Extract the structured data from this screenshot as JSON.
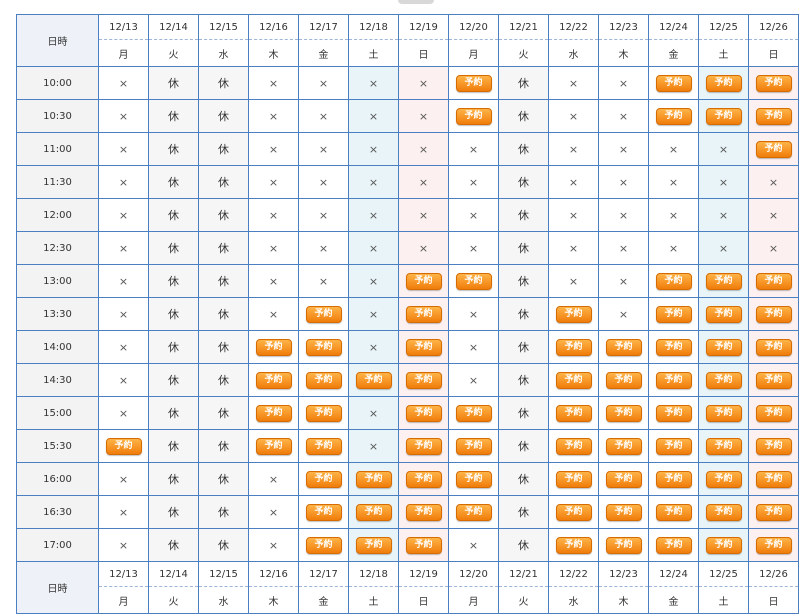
{
  "corner_label": "日時",
  "dates": [
    "12/13",
    "12/14",
    "12/15",
    "12/16",
    "12/17",
    "12/18",
    "12/19",
    "12/20",
    "12/21",
    "12/22",
    "12/23",
    "12/24",
    "12/25",
    "12/26"
  ],
  "weekdays": [
    "月",
    "火",
    "水",
    "木",
    "金",
    "土",
    "日",
    "月",
    "火",
    "水",
    "木",
    "金",
    "土",
    "日"
  ],
  "labels": {
    "unavailable": "×",
    "closed": "休",
    "reserve": "予約"
  },
  "colors": {
    "grid": "#4a7fc1",
    "reserve_button": "#f07d0b",
    "saturday_bg": "#e8f4f8",
    "sunday_bg": "#fdf0f0"
  },
  "rows": [
    {
      "time": "10:00",
      "cells": [
        "x",
        "c",
        "c",
        "x",
        "x",
        "x",
        "x",
        "r",
        "c",
        "x",
        "x",
        "r",
        "r",
        "r"
      ]
    },
    {
      "time": "10:30",
      "cells": [
        "x",
        "c",
        "c",
        "x",
        "x",
        "x",
        "x",
        "r",
        "c",
        "x",
        "x",
        "r",
        "r",
        "r"
      ]
    },
    {
      "time": "11:00",
      "cells": [
        "x",
        "c",
        "c",
        "x",
        "x",
        "x",
        "x",
        "x",
        "c",
        "x",
        "x",
        "x",
        "x",
        "r"
      ]
    },
    {
      "time": "11:30",
      "cells": [
        "x",
        "c",
        "c",
        "x",
        "x",
        "x",
        "x",
        "x",
        "c",
        "x",
        "x",
        "x",
        "x",
        "x"
      ]
    },
    {
      "time": "12:00",
      "cells": [
        "x",
        "c",
        "c",
        "x",
        "x",
        "x",
        "x",
        "x",
        "c",
        "x",
        "x",
        "x",
        "x",
        "x"
      ]
    },
    {
      "time": "12:30",
      "cells": [
        "x",
        "c",
        "c",
        "x",
        "x",
        "x",
        "x",
        "x",
        "c",
        "x",
        "x",
        "x",
        "x",
        "x"
      ]
    },
    {
      "time": "13:00",
      "cells": [
        "x",
        "c",
        "c",
        "x",
        "x",
        "x",
        "r",
        "r",
        "c",
        "x",
        "x",
        "r",
        "r",
        "r"
      ]
    },
    {
      "time": "13:30",
      "cells": [
        "x",
        "c",
        "c",
        "x",
        "r",
        "x",
        "r",
        "x",
        "c",
        "r",
        "x",
        "r",
        "r",
        "r"
      ]
    },
    {
      "time": "14:00",
      "cells": [
        "x",
        "c",
        "c",
        "r",
        "r",
        "x",
        "r",
        "x",
        "c",
        "r",
        "r",
        "r",
        "r",
        "r"
      ]
    },
    {
      "time": "14:30",
      "cells": [
        "x",
        "c",
        "c",
        "r",
        "r",
        "r",
        "r",
        "x",
        "c",
        "r",
        "r",
        "r",
        "r",
        "r"
      ]
    },
    {
      "time": "15:00",
      "cells": [
        "x",
        "c",
        "c",
        "r",
        "r",
        "x",
        "r",
        "r",
        "c",
        "r",
        "r",
        "r",
        "r",
        "r"
      ]
    },
    {
      "time": "15:30",
      "cells": [
        "r",
        "c",
        "c",
        "r",
        "r",
        "x",
        "r",
        "r",
        "c",
        "r",
        "r",
        "r",
        "r",
        "r"
      ]
    },
    {
      "time": "16:00",
      "cells": [
        "x",
        "c",
        "c",
        "x",
        "r",
        "r",
        "r",
        "r",
        "c",
        "r",
        "r",
        "r",
        "r",
        "r"
      ]
    },
    {
      "time": "16:30",
      "cells": [
        "x",
        "c",
        "c",
        "x",
        "r",
        "r",
        "r",
        "r",
        "c",
        "r",
        "r",
        "r",
        "r",
        "r"
      ]
    },
    {
      "time": "17:00",
      "cells": [
        "x",
        "c",
        "c",
        "x",
        "r",
        "r",
        "r",
        "x",
        "c",
        "r",
        "r",
        "r",
        "r",
        "r"
      ]
    }
  ]
}
